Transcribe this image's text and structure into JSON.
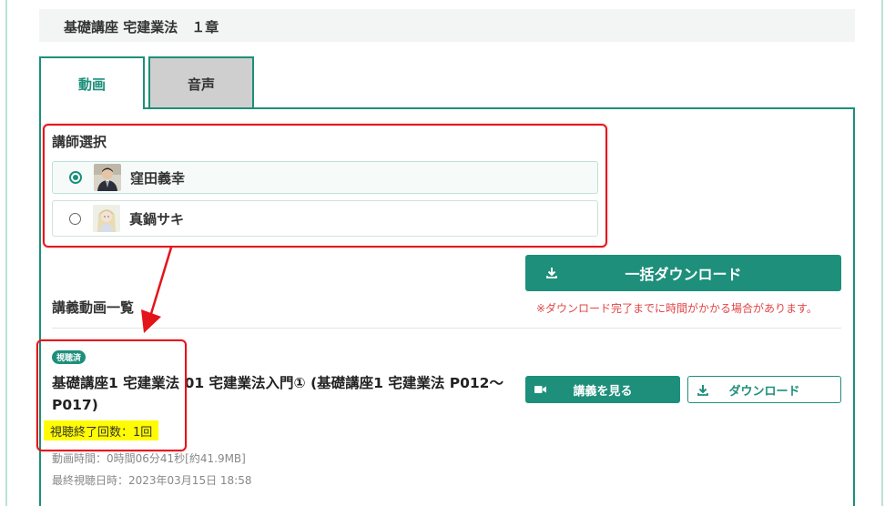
{
  "chapter": {
    "title": "基礎講座 宅建業法　１章"
  },
  "tabs": [
    {
      "label": "動画",
      "active": true
    },
    {
      "label": "音声",
      "active": false
    }
  ],
  "instructor_select": {
    "label": "講師選択",
    "options": [
      {
        "name": "窪田義幸",
        "selected": true
      },
      {
        "name": "真鍋サキ",
        "selected": false
      }
    ]
  },
  "download_all": {
    "label": "一括ダウンロード",
    "note": "※ダウンロード完了までに時間がかかる場合があります。"
  },
  "lecture_list": {
    "title": "講義動画一覧",
    "items": [
      {
        "badge": "視聴済",
        "title": "基礎講座1 宅建業法 01 宅建業法入門① (基礎講座1 宅建業法 P012～P017)",
        "watch_count": "視聴終了回数：1回",
        "duration": "動画時間：0時間06分41秒[約41.9MB]",
        "last_watched": "最終視聴日時：2023年03月15日 18:58",
        "watch_label": "講義を見る",
        "download_label": "ダウンロード"
      }
    ]
  },
  "colors": {
    "accent": "#1d8f7b",
    "annotation": "#e4141b",
    "highlight": "#fffb00",
    "note": "#e04646"
  }
}
